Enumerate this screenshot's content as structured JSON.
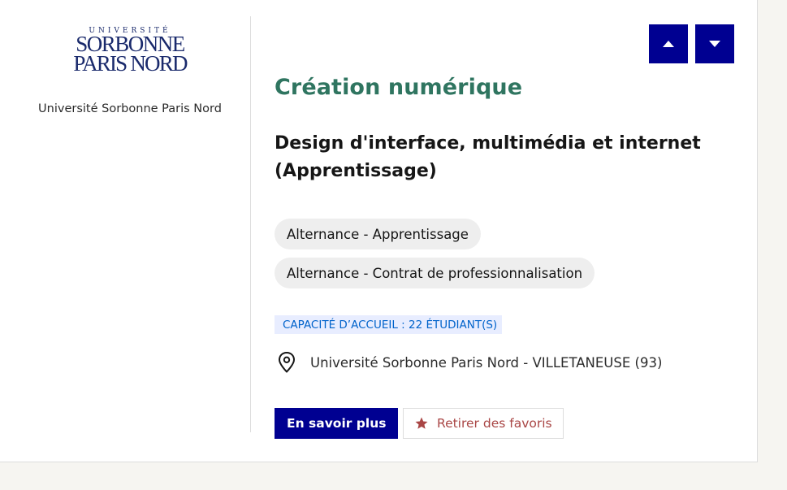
{
  "institution": {
    "logo": {
      "small_text": "UNIVERSITÉ",
      "line1": "SORBONNE",
      "line2": "PARIS NORD",
      "color": "#1a2a6c"
    },
    "name": "Université Sorbonne Paris Nord"
  },
  "navigation": {
    "up_icon": "caret-up-icon",
    "down_icon": "caret-down-icon"
  },
  "formation": {
    "category": "Création numérique",
    "title": "Design d'interface, multimédia et internet (Apprentissage)",
    "tags": [
      "Alternance - Apprentissage",
      "Alternance - Contrat de professionnalisation"
    ],
    "capacity": "CAPACITÉ D’ACCUEIL : 22 ÉTUDIANT(S)",
    "location": "Université Sorbonne Paris Nord - VILLETANEUSE (93)"
  },
  "actions": {
    "more_label": "En savoir plus",
    "remove_favorite_label": "Retirer des favoris"
  },
  "colors": {
    "primary": "#000091",
    "category": "#2f7560",
    "favorite": "#a94645",
    "capacity_text": "#0063cb",
    "capacity_bg": "#e8edff"
  }
}
